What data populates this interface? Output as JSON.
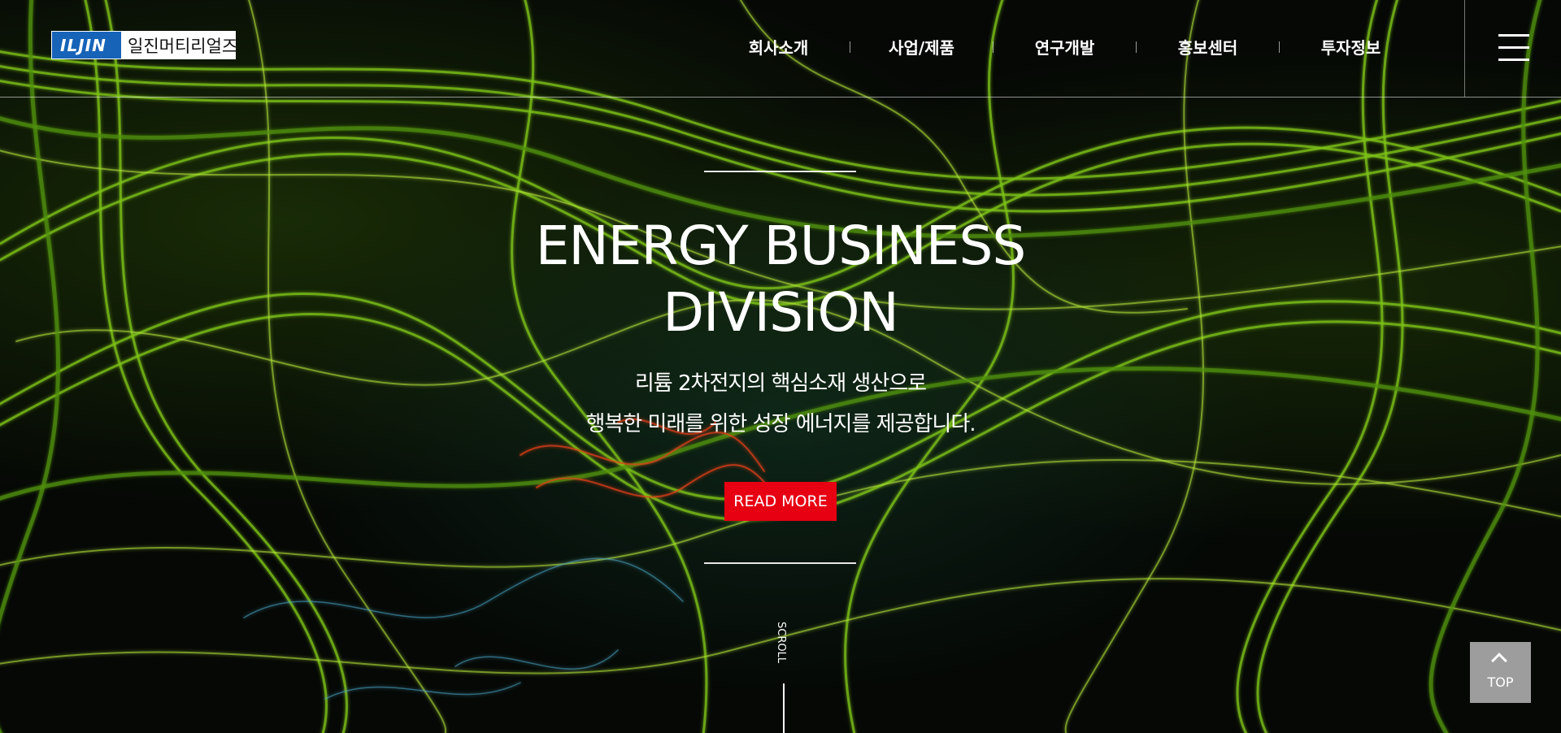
{
  "header": {
    "logo_mark": "ILJIN",
    "logo_name": "일진머티리얼즈",
    "nav_items": [
      "회사소개",
      "사업/제품",
      "연구개발",
      "홍보센터",
      "투자정보"
    ]
  },
  "hero": {
    "title": "ENERGY BUSINESS\nDIVISION",
    "subtitle_line1": "리튬 2차전지의 핵심소재 생산으로",
    "subtitle_line2": "행복한 미래를 위한 성장 에너지를 제공합니다.",
    "cta_label": "READ MORE",
    "scroll_label": "SCROLL"
  },
  "top_button": {
    "label": "TOP",
    "icon": "chevron-up-icon"
  },
  "menu_button": {
    "icon": "hamburger-menu-icon"
  },
  "colors": {
    "brand_blue": "#1763b8",
    "cta_red": "#e60012",
    "neon_green": "#8fd400"
  }
}
